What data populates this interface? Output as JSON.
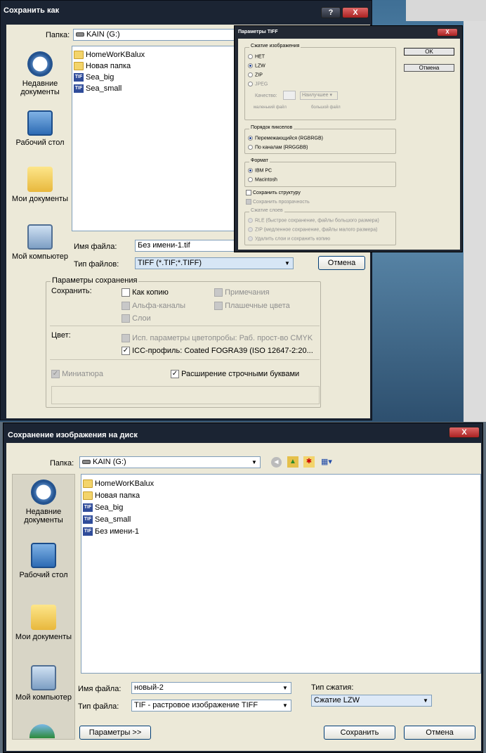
{
  "window1": {
    "title": "Сохранить как",
    "help_btn": "?",
    "close_btn": "X",
    "folder_label": "Папка:",
    "folder_value": "KAIN (G:)",
    "places": [
      "Недавние документы",
      "Рабочий стол",
      "Мои документы",
      "Мой компьютер"
    ],
    "files": [
      {
        "name": "HomeWorKBalux",
        "icon": "folder-icon",
        "type_label": ""
      },
      {
        "name": "Новая папка",
        "icon": "folder-icon",
        "type_label": ""
      },
      {
        "name": "Sea_big",
        "icon": "tif-file-icon",
        "type_label": "TIF"
      },
      {
        "name": "Sea_small",
        "icon": "tif-file-icon",
        "type_label": "TIF"
      }
    ],
    "filename_label": "Имя файла:",
    "filename_value": "Без имени-1.tif",
    "filetype_label": "Тип файлов:",
    "filetype_value": "TIFF (*.TIF;*.TIFF)",
    "cancel_label": "Отмена",
    "save_params_title": "Параметры сохранения",
    "save_label": "Сохранить:",
    "as_copy": "Как копию",
    "notes": "Примечания",
    "alpha_channels": "Альфа-каналы",
    "spot_colors": "Плашечные цвета",
    "layers": "Слои",
    "color_label": "Цвет:",
    "use_proof": "Исп. параметры цветопробы:  Раб. прост-во CMYK",
    "icc_profile": "ICC-профиль:  Coated FOGRA39 (ISO 12647-2:20...",
    "thumbnail": "Миниатюра",
    "lowercase_ext": "Расширение строчными буквами"
  },
  "tiff_dialog": {
    "title": "Параметры TIFF",
    "close_btn": "X",
    "compression_title": "Сжатие изображения",
    "compression_options": [
      "НЕТ",
      "LZW",
      "ZIP",
      "JPEG"
    ],
    "compression_selected": "LZW",
    "quality_label": "Качество:",
    "quality_combo": "Наилучшее",
    "small_file": "маленький файл",
    "large_file": "большой файл",
    "pixel_order_title": "Порядок пикселов",
    "pixel_order_options": [
      "Перемежающийся (RGBRGB)",
      "По каналам (RRGGBB)"
    ],
    "format_title": "Формат",
    "format_options": [
      "IBM PC",
      "Macintosh"
    ],
    "save_pyramid": "Сохранить структуру",
    "save_transparency": "Сохранить прозрачность",
    "layer_compression_title": "Сжатие слоев",
    "layer_compression_options": [
      "RLE (быстрое сохранение, файлы большого размера)",
      "ZIP (медленное сохранение, файлы малого размера)",
      "Удалить слои и сохранить копию"
    ],
    "ok": "OK",
    "cancel": "Отмена"
  },
  "window2": {
    "title": "Сохранение изображения на диск",
    "close_btn": "X",
    "folder_label": "Папка:",
    "folder_value": "KAIN (G:)",
    "places": [
      "Недавние документы",
      "Рабочий стол",
      "Мои документы",
      "Мой компьютер"
    ],
    "files": [
      {
        "name": "HomeWorKBalux",
        "icon": "folder-icon",
        "type_label": ""
      },
      {
        "name": "Новая папка",
        "icon": "folder-icon",
        "type_label": ""
      },
      {
        "name": "Sea_big",
        "icon": "tif-file-icon",
        "type_label": "TIF"
      },
      {
        "name": "Sea_small",
        "icon": "tif-file-icon",
        "type_label": "TIF"
      },
      {
        "name": "Без имени-1",
        "icon": "tif-file-icon",
        "type_label": "TIF"
      }
    ],
    "filename_label": "Имя файла:",
    "filename_value": "новый-2",
    "filetype_label": "Тип файла:",
    "filetype_value": "TIF - растровое изображение TIFF",
    "compression_label": "Тип сжатия:",
    "compression_value": "Сжатие LZW",
    "params_button": "Параметры >>",
    "save_button": "Сохранить",
    "cancel_button": "Отмена"
  }
}
